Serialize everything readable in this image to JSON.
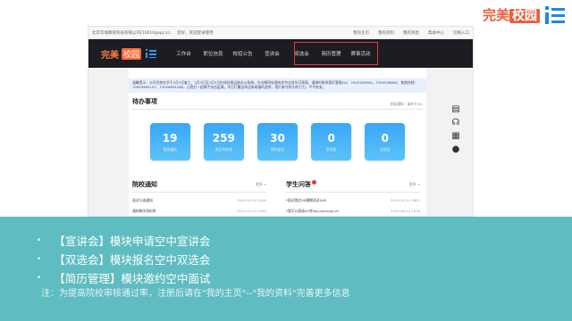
{
  "brand": {
    "prefix": "完美",
    "box": "校园"
  },
  "frame": {
    "top_left": "北京华瑞教育科技有限公司(10010@qq.co...",
    "top_mid": "您好，欢迎登录使用",
    "top_links": [
      "我的主页",
      "我的资料",
      "我的消息",
      "帮助中心",
      "切换入口"
    ],
    "nav": {
      "logo_prefix": "完美",
      "logo_box": "校园",
      "items": [
        "工作台",
        "职位信息",
        "校招公告",
        "宣讲会",
        "双选会",
        "简历管理",
        "赛事活动"
      ]
    },
    "notice": "温馨提示：公司目前在学于2月3日复工，2月3日至2月5日在线处理运维办公系统，在法期间处理有任何业务均可直接，请随时联系我们客服QQ：2945109945，2394528804；售前热线：15629965157，13526654186，让我们一起携手抗击疫情，早日打赢这场没有硝烟的战争，我们来守你大的力力，平平安安。",
    "notice_link": "发起通知：请补大卡1",
    "todo_title": "待办事项",
    "cards": [
      {
        "num": "19",
        "label": "系统通知"
      },
      {
        "num": "259",
        "label": "简历待处理"
      },
      {
        "num": "30",
        "label": "预约面试"
      },
      {
        "num": "0",
        "label": "宣讲会"
      },
      {
        "num": "0",
        "label": "双选会"
      }
    ],
    "left_section": {
      "title": "院校通知",
      "more": "更多 >",
      "rows": [
        {
          "text": "面试与选通知",
          "date": "2019-12-04 2018"
        },
        {
          "text": "通知教学资料库",
          "date": "2019-12-04 1540"
        }
      ]
    },
    "right_section": {
      "title": "学生问答",
      "more": "更多 >",
      "rows": [
        {
          "text": "*面试我应XX模糊测试XXX",
          "date": "2019-10-21 0801"
        },
        {
          "text": "*我可以直接XX考lxjin/xkxxxjp-01",
          "date": "2019-06-14 1918"
        }
      ]
    },
    "side_icons": [
      "document-icon",
      "headset-icon",
      "qrcode-icon",
      "chat-icon"
    ]
  },
  "bullets": [
    "【宣讲会】模块申请空中宣讲会",
    "【双选会】模块报名空中双选会",
    "【简历管理】模块邀约空中面试"
  ],
  "note": "注：为提高院校审核通过率，注册后请在\"我的主页\"--\"我的资料\"完善更多信息",
  "colors": {
    "band": "#5fbcc0",
    "accent": "#e8603c",
    "card": "#39a7f7",
    "highlight": "#e53935"
  }
}
